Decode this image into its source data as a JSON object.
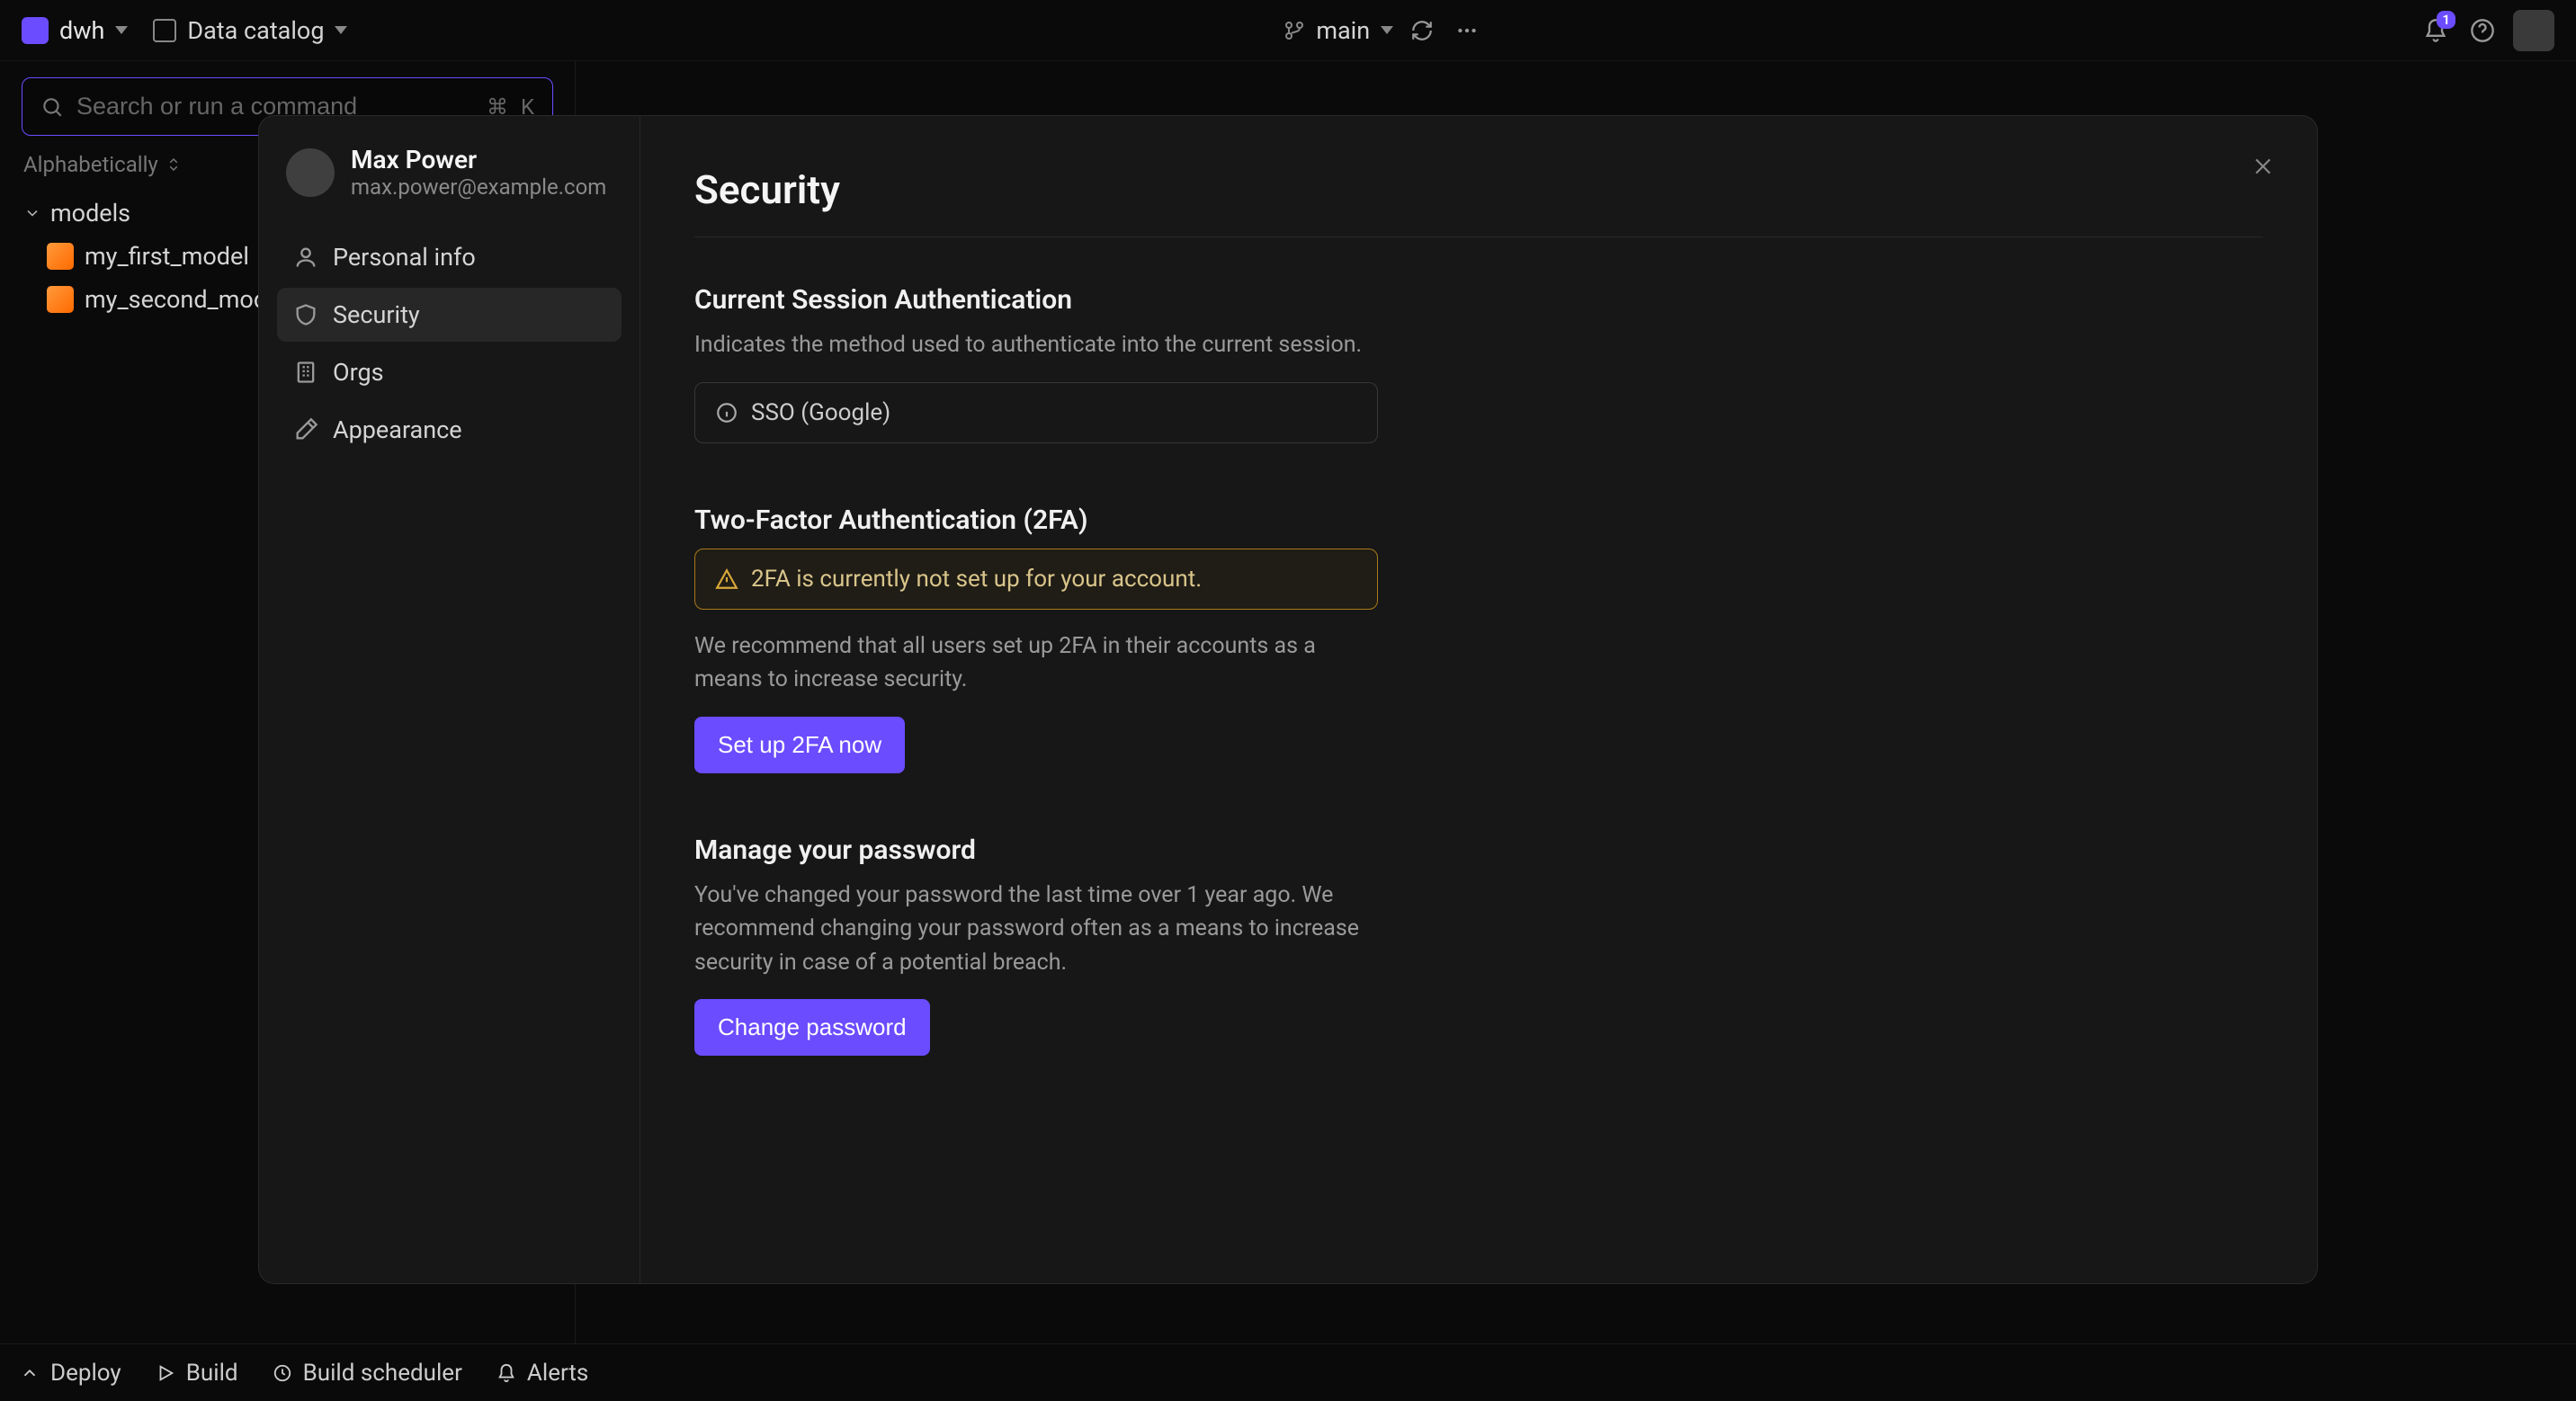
{
  "topbar": {
    "workspace_label": "dwh",
    "catalog_label": "Data catalog",
    "branch_label": "main",
    "notif_count": "1"
  },
  "sidebar": {
    "search_placeholder": "Search or run a command",
    "shortcut_mod": "⌘",
    "shortcut_key": "K",
    "sort_label": "Alphabetically",
    "folder_label": "models",
    "items": [
      {
        "label": "my_first_model"
      },
      {
        "label": "my_second_model"
      }
    ]
  },
  "modal": {
    "user": {
      "name": "Max Power",
      "email": "max.power@example.com"
    },
    "nav": {
      "personal": "Personal info",
      "security": "Security",
      "orgs": "Orgs",
      "appearance": "Appearance"
    },
    "page_title": "Security",
    "session": {
      "title": "Current Session Authentication",
      "desc": "Indicates the method used to authenticate into the current session.",
      "value": "SSO (Google)"
    },
    "twofa": {
      "title": "Two-Factor Authentication (2FA)",
      "warning": "2FA is currently not set up for your account.",
      "desc": "We recommend that all users set up 2FA in their accounts as a means to increase security.",
      "button": "Set up 2FA now"
    },
    "password": {
      "title": "Manage your password",
      "desc": "You've changed your password the last time over 1 year ago. We recommend changing your password often as a means to increase security in case of a potential breach.",
      "button": "Change password"
    }
  },
  "statusbar": {
    "deploy": "Deploy",
    "build": "Build",
    "scheduler": "Build scheduler",
    "alerts": "Alerts"
  }
}
